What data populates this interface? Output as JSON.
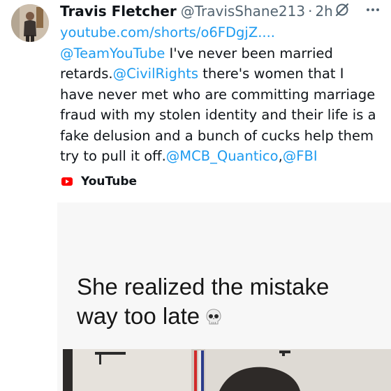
{
  "tweet": {
    "author_name": "Travis Fletcher",
    "handle": "@TravisShane213",
    "separator": "·",
    "time": "2h",
    "body_lines": [
      [
        {
          "text": "youtube.com/shorts/o6FDgjZ....",
          "link": true
        }
      ],
      [
        {
          "text": "@TeamYouTube",
          "link": true
        },
        {
          "text": " I've never been married",
          "link": false
        }
      ],
      [
        {
          "text": "retards.",
          "link": false
        },
        {
          "text": "@CivilRights",
          "link": true
        },
        {
          "text": " there's women that I",
          "link": false
        }
      ],
      [
        {
          "text": "have never met who are committing marriage",
          "link": false
        }
      ],
      [
        {
          "text": "fraud with my stolen identity and their life is a",
          "link": false
        }
      ],
      [
        {
          "text": "fake delusion and a bunch of cucks help them",
          "link": false
        }
      ],
      [
        {
          "text": "try to pull it off.",
          "link": false
        },
        {
          "text": "@MCB_Quantico",
          "link": true
        },
        {
          "text": ",",
          "link": false
        },
        {
          "text": "@FBI",
          "link": true
        }
      ]
    ]
  },
  "source": {
    "icon": "youtube-logo-icon",
    "label": "YouTube"
  },
  "media": {
    "caption_lines": [
      "She realized the mistake",
      "way too late"
    ],
    "caption_emoji": "skull-icon"
  },
  "colors": {
    "link": "#1d9bf0",
    "secondary_text": "#536471",
    "youtube_red": "#ff0000"
  }
}
